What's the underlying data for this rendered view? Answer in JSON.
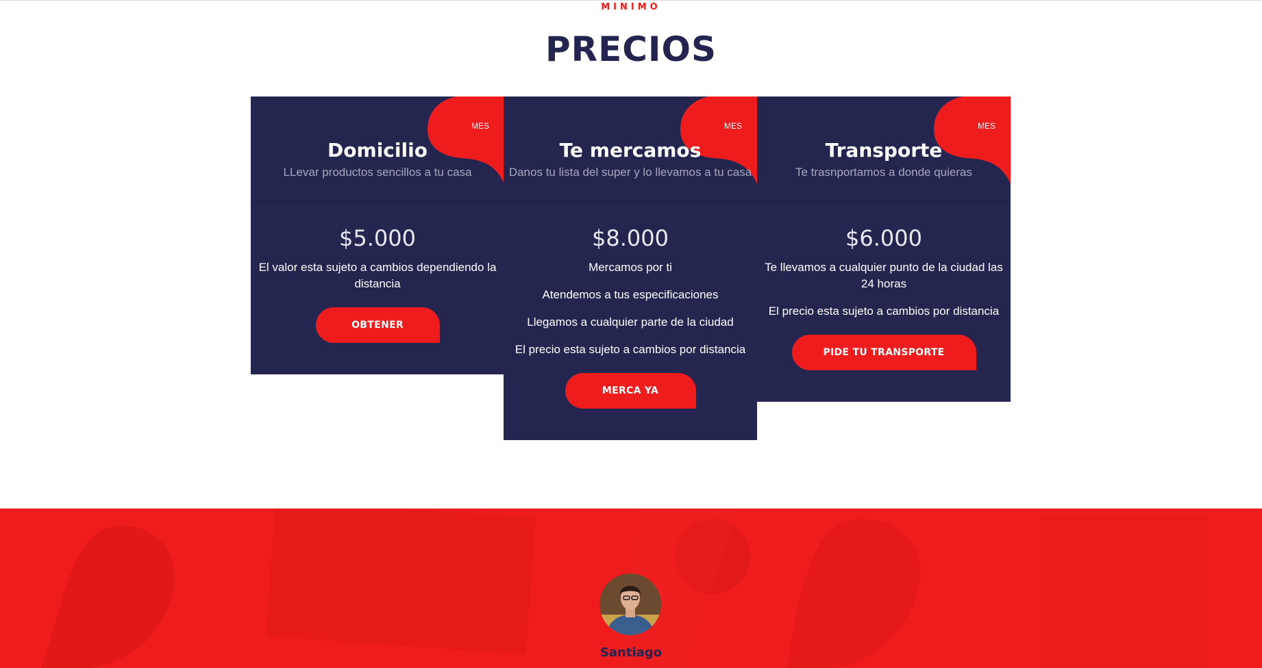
{
  "section": {
    "eyebrow": "MINIMO",
    "title": "PRECIOS"
  },
  "colors": {
    "accent": "#ee1c1c",
    "card_bg": "#252650",
    "heading": "#242450"
  },
  "plans": [
    {
      "badge": "MES",
      "title": "Domicilio",
      "subtitle": "LLevar productos sencillos a tu casa",
      "price": "$5.000",
      "features": [
        "El valor esta sujeto a cambios dependiendo la distancia"
      ],
      "button": "OBTENER"
    },
    {
      "badge": "MES",
      "title": "Te mercamos",
      "subtitle": "Danos tu lista del super y lo llevamos a tu casa",
      "price": "$8.000",
      "features": [
        "Mercamos por ti",
        "Atendemos a tus especificaciones",
        "Llegamos a cualquier parte de la ciudad",
        "El precio esta sujeto a cambios por distancia"
      ],
      "button": "MERCA YA"
    },
    {
      "badge": "MES",
      "title": "Transporte",
      "subtitle": "Te trasnportamos a donde quieras",
      "price": "$6.000",
      "features": [
        "Te llevamos a cualquier punto de la ciudad las 24 horas",
        "El precio esta sujeto a cambios por distancia"
      ],
      "button": "PIDE TU TRANSPORTE"
    }
  ],
  "testimonial": {
    "author": "Santiago",
    "avatar_icon": "person-avatar"
  }
}
